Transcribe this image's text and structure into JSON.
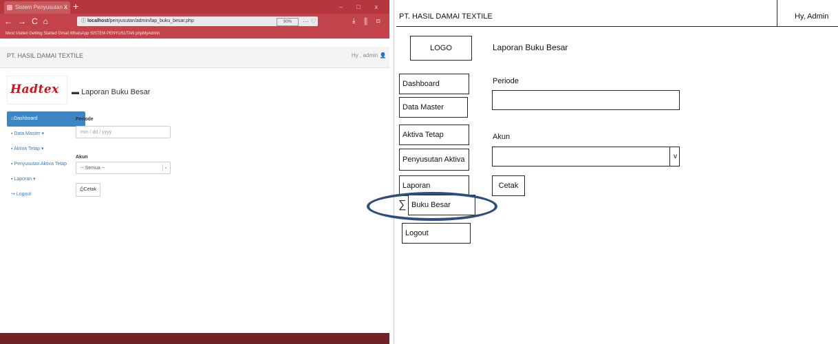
{
  "browser": {
    "tab_title": "Sistem Penyusutan",
    "tab_close": "x",
    "new_tab": "+",
    "window_controls": "– □ x",
    "nav_buttons": [
      "←",
      "→",
      "C",
      "⌂"
    ],
    "url_host": "localhost",
    "url_path": "/penyusutan/admin/lap_buku_besar.php",
    "zoom": "90%",
    "page_actions": "··· ♡ ☆",
    "toolbar_right": "⤓ ⫼ ⊡ ≡",
    "bookmarks": "Most Visited   Getting Started   Gmail   WhatsApp   SISTEM PENYUSUTAN   phpMyAdmin"
  },
  "app": {
    "brand": "PT. HASIL DAMAI TEXTILE",
    "user": "Hy , admin",
    "logo_text": "Hadtex",
    "page_title": "Laporan Buku Besar",
    "sidebar": [
      {
        "label": "Dashboard",
        "active": true
      },
      {
        "label": "Data Master ▾",
        "active": false
      },
      {
        "label": "Aktiva Tetap ▾",
        "active": false
      },
      {
        "label": "Penyusutan Aktiva Tetap",
        "active": false
      },
      {
        "label": "Laporan ▾",
        "active": false
      },
      {
        "label": "Logout",
        "active": false
      }
    ],
    "form": {
      "periode_label": "Periode",
      "periode_placeholder": "mm / dd / yyyy",
      "akun_label": "Akun",
      "akun_selected": "-- Semua --",
      "cetak_label": "Cetak"
    }
  },
  "wireframe": {
    "brand": "PT. HASIL DAMAI TEXTILE",
    "user": "Hy, Admin",
    "logo": "LOGO",
    "title": "Laporan Buku Besar",
    "nav": {
      "dashboard": "Dashboard",
      "data_master": "Data Master",
      "aktiva_tetap": "Aktiva Tetap",
      "penyusutan": "Penyusutan Aktiva Tetap",
      "laporan": "Laporan",
      "buku_besar": "Buku Besar",
      "logout": "Logout"
    },
    "periode_label": "Periode",
    "akun_label": "Akun",
    "select_arrow": "v",
    "cetak_label": "Cetak"
  },
  "colors": {
    "browser_chrome": "#b5373d",
    "sidebar_active": "#3d86c6",
    "link": "#3a7cc2",
    "logo_red": "#c8161e",
    "highlight_ring": "#2e4d7e",
    "footer": "#6f2327"
  }
}
